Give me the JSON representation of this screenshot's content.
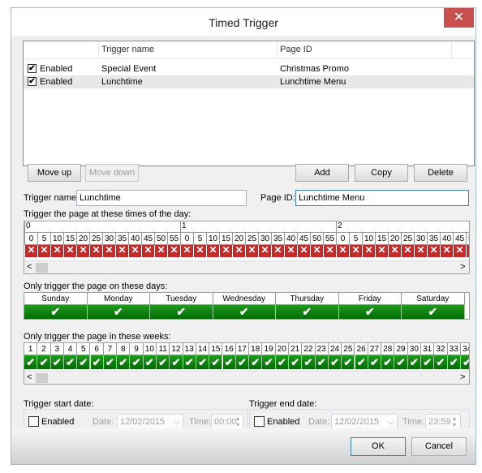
{
  "window": {
    "title": "Timed Trigger"
  },
  "list": {
    "columns": [
      "Trigger name",
      "Page ID"
    ],
    "rows": [
      {
        "enabled_label": "Enabled",
        "checked": true,
        "name": "Special Event",
        "page": "Christmas Promo"
      },
      {
        "enabled_label": "Enabled",
        "checked": true,
        "name": "Lunchtime",
        "page": "Lunchtime Menu"
      }
    ]
  },
  "buttons": {
    "move_up": "Move up",
    "move_down": "Move down",
    "add": "Add",
    "copy": "Copy",
    "delete": "Delete",
    "ok": "OK",
    "cancel": "Cancel"
  },
  "form": {
    "trigger_name_label": "Trigger name:",
    "trigger_name_value": "Lunchtime",
    "page_id_label": "Page ID:",
    "page_id_value": "Lunchtime Menu"
  },
  "times": {
    "label": "Trigger the page at these times of the day:",
    "hours": [
      "0",
      "1",
      "2"
    ],
    "minutes": [
      "0",
      "5",
      "10",
      "15",
      "20",
      "25",
      "30",
      "35",
      "40",
      "45",
      "50",
      "55"
    ],
    "all_disabled": true
  },
  "days": {
    "label": "Only trigger the page on these days:",
    "names": [
      "Sunday",
      "Monday",
      "Tuesday",
      "Wednesday",
      "Thursday",
      "Friday",
      "Saturday"
    ],
    "all_enabled": true
  },
  "weeks": {
    "label": "Only trigger the page in  these weeks:",
    "visible_count": 34,
    "all_enabled": true
  },
  "start": {
    "label": "Trigger start date:",
    "enabled": "Enabled",
    "date_label": "Date:",
    "date": "12/02/2015",
    "time_label": "Time:",
    "time": "00:00"
  },
  "end": {
    "label": "Trigger end date:",
    "enabled": "Enabled",
    "date_label": "Date:",
    "date": "12/02/2015",
    "time_label": "Time:",
    "time": "23:59"
  },
  "colors": {
    "accent_red": "#c82a2a",
    "accent_green": "#006b00",
    "close": "#c94f4f"
  }
}
